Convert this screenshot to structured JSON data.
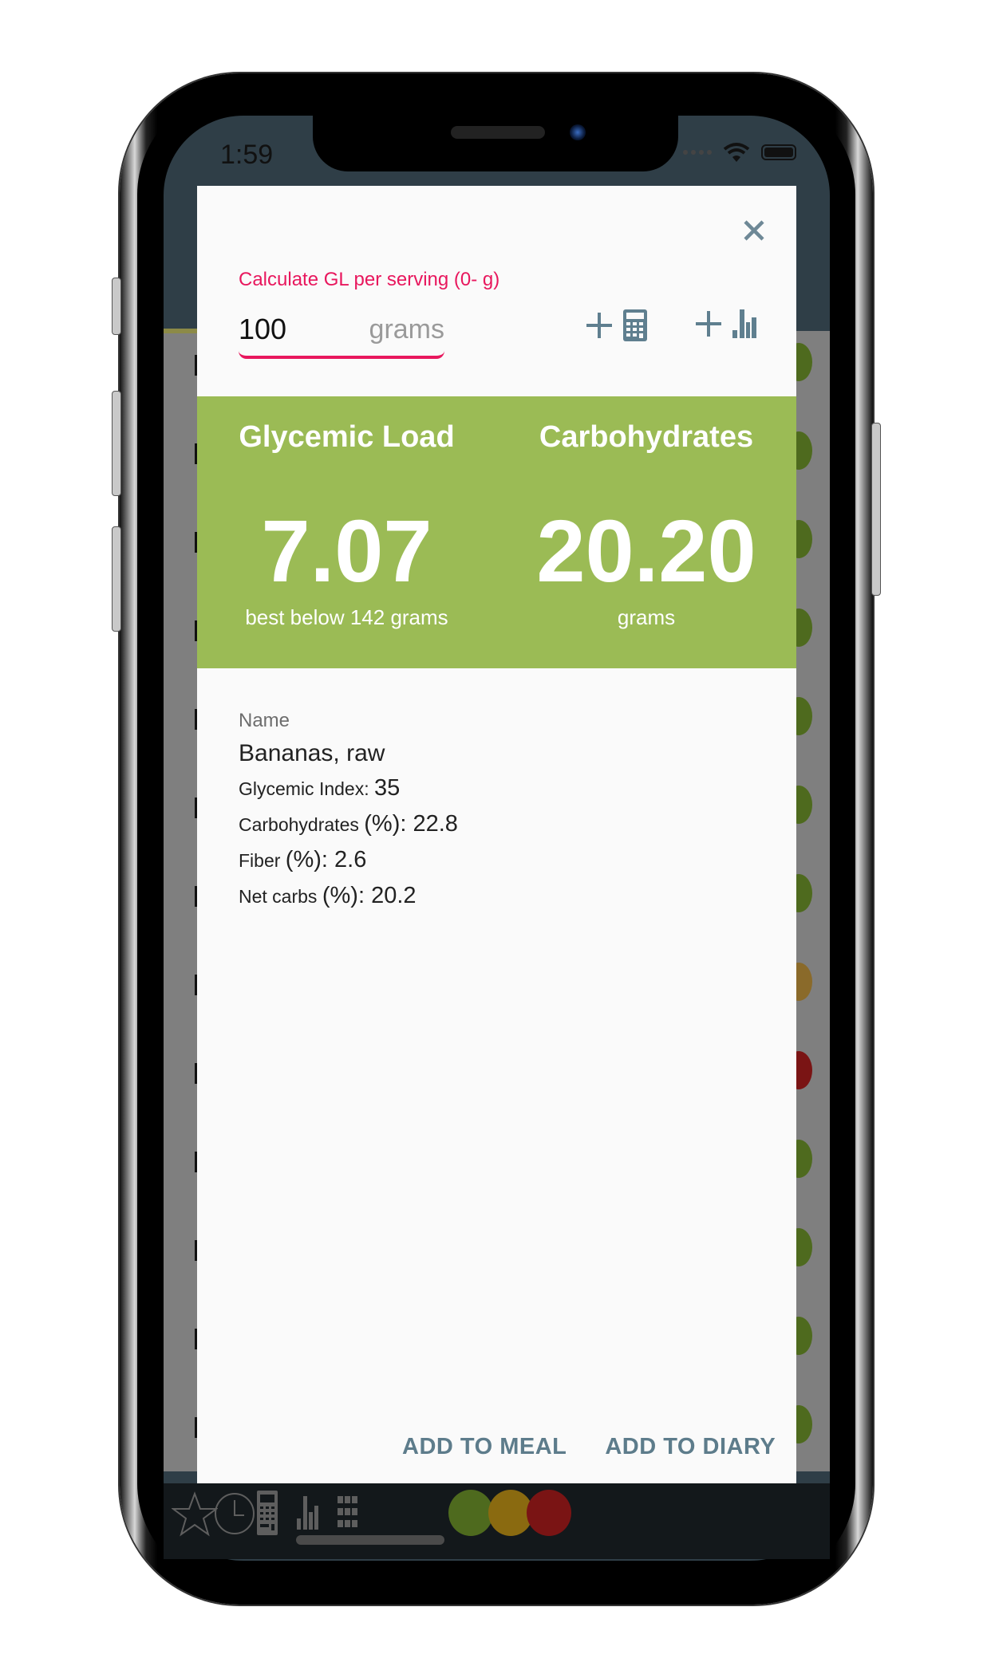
{
  "status_bar": {
    "time": "1:59"
  },
  "modal": {
    "close_icon": "close-icon",
    "input_label": "Calculate GL per serving (0- g)",
    "serving_value": "100",
    "serving_unit": "grams",
    "tools": [
      {
        "name": "add-to-calculator",
        "icons": [
          "plus-icon",
          "calculator-icon"
        ]
      },
      {
        "name": "add-to-chart",
        "icons": [
          "plus-icon",
          "bar-chart-icon"
        ]
      }
    ],
    "summary": {
      "background_color": "#9bbb55",
      "glycemic_load": {
        "title": "Glycemic Load",
        "value": "7.07",
        "subtitle": "best below 142 grams"
      },
      "carbohydrates": {
        "title": "Carbohydrates",
        "value": "20.20",
        "subtitle": "grams"
      }
    },
    "details": {
      "name_label": "Name",
      "name_value": "Bananas, raw",
      "rows": [
        {
          "label": "Glycemic Index",
          "value": "35"
        },
        {
          "label": "Carbohydrates",
          "unit": "(%)",
          "value": "22.8"
        },
        {
          "label": "Fiber",
          "unit": "(%)",
          "value": "2.6"
        },
        {
          "label": "Net carbs",
          "unit": "(%)",
          "value": "20.2"
        }
      ]
    },
    "actions": {
      "add_to_meal": "ADD TO MEAL",
      "add_to_diary": "ADD TO DIARY"
    }
  },
  "bottom_nav": {
    "items": [
      "star-icon",
      "clock-icon",
      "calculator-icon",
      "bar-chart-icon",
      "grid-icon"
    ],
    "filters": [
      {
        "name": "green",
        "color": "#4e6a1e"
      },
      {
        "name": "yellow",
        "color": "#8a6a10"
      },
      {
        "name": "red",
        "color": "#7a1414"
      }
    ]
  },
  "accent_colors": {
    "primary": "#e8175d",
    "icon": "#5f7f8f",
    "green_panel": "#9bbb55",
    "app_bar": "#2f3e47"
  }
}
